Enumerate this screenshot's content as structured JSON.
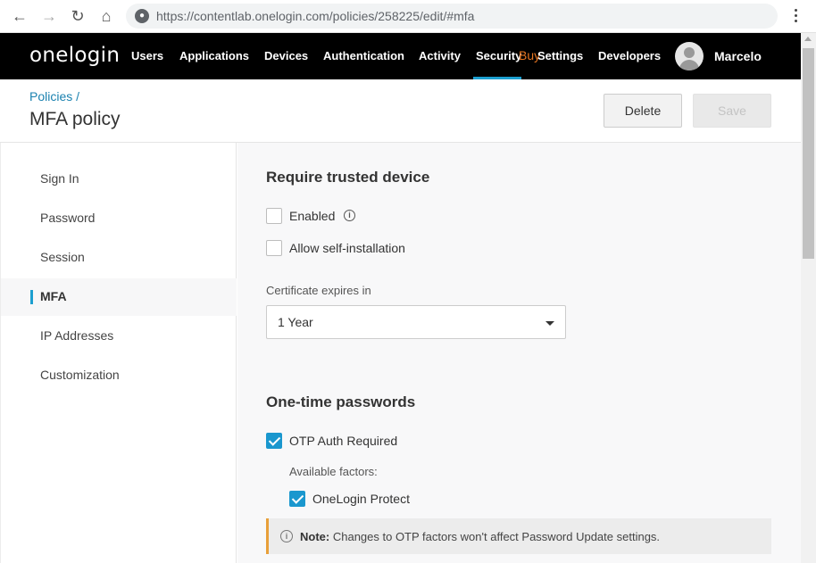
{
  "browser": {
    "url": "https://contentlab.onelogin.com/policies/258225/edit/#mfa"
  },
  "nav": {
    "logo": "onelogin",
    "items": [
      "Users",
      "Applications",
      "Devices",
      "Authentication",
      "Activity",
      "Security",
      "Settings",
      "Developers"
    ],
    "buy_label": "Buy",
    "active_item": "Security",
    "user_name": "Marcelo"
  },
  "header": {
    "breadcrumb": "Policies /",
    "title": "MFA policy",
    "delete_label": "Delete",
    "save_label": "Save"
  },
  "sidebar": {
    "items": [
      {
        "label": "Sign In"
      },
      {
        "label": "Password"
      },
      {
        "label": "Session"
      },
      {
        "label": "MFA",
        "active": true
      },
      {
        "label": "IP Addresses"
      },
      {
        "label": "Customization"
      }
    ]
  },
  "main": {
    "trusted_device": {
      "title": "Require trusted device",
      "enabled_label": "Enabled",
      "enabled_checked": false,
      "self_install_label": "Allow self-installation",
      "self_install_checked": false,
      "cert_label": "Certificate expires in",
      "cert_value": "1 Year"
    },
    "otp": {
      "title": "One-time passwords",
      "required_label": "OTP Auth Required",
      "required_checked": true,
      "factors_label": "Available factors:",
      "protect_label": "OneLogin Protect",
      "protect_checked": true
    },
    "note": {
      "prefix": "Note:",
      "text": "Changes to OTP factors won't affect Password Update settings."
    }
  },
  "colors": {
    "accent": "#1c9fd0",
    "buy": "#e87722",
    "note_border": "#e8a03a",
    "nav_bg": "#000000"
  }
}
